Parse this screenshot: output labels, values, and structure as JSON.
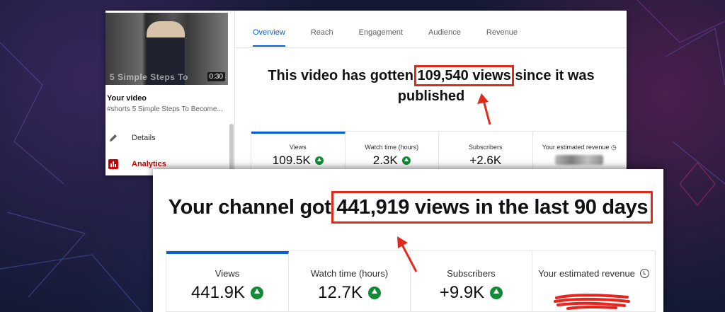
{
  "video_panel": {
    "thumbnail": {
      "overlay_text": "5 Simple Steps To",
      "duration": "0:30"
    },
    "title": "Your video",
    "subtitle": "#shorts 5 Simple Steps To Become...",
    "nav": [
      {
        "label": "Details",
        "icon": "pencil-icon"
      },
      {
        "label": "Analytics",
        "icon": "analytics-icon"
      }
    ],
    "tabs": [
      "Overview",
      "Reach",
      "Engagement",
      "Audience",
      "Revenue"
    ],
    "active_tab": "Overview",
    "headline": {
      "before": "This video has gotten ",
      "highlight": "109,540 views",
      "after": " since it was published"
    },
    "metrics": [
      {
        "label": "Views",
        "value": "109.5K",
        "trend": "up"
      },
      {
        "label": "Watch time (hours)",
        "value": "2.3K",
        "trend": "up"
      },
      {
        "label": "Subscribers",
        "value": "+2.6K",
        "trend": "none"
      },
      {
        "label": "Your estimated revenue",
        "value": "",
        "trend": "info"
      }
    ]
  },
  "channel_panel": {
    "headline": {
      "before": "Your channel got ",
      "highlight": "441,919 views in the last 90 days"
    },
    "metrics": [
      {
        "label": "Views",
        "value": "441.9K",
        "trend": "up"
      },
      {
        "label": "Watch time (hours)",
        "value": "12.7K",
        "trend": "up"
      },
      {
        "label": "Subscribers",
        "value": "+9.9K",
        "trend": "up"
      },
      {
        "label": "Your estimated revenue",
        "value": "",
        "trend": "info"
      }
    ]
  },
  "colors": {
    "accent_blue": "#065fd4",
    "highlight_red": "#e02a1c",
    "trend_green": "#128b37",
    "analytics_red": "#cc0000"
  }
}
